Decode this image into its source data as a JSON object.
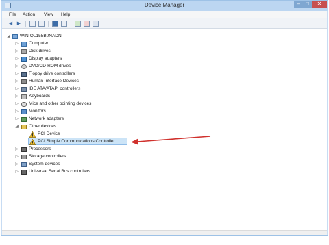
{
  "window": {
    "title": "Device Manager",
    "min_glyph": "–",
    "max_glyph": "□",
    "close_glyph": "✕"
  },
  "menu": {
    "items": [
      "File",
      "Action",
      "View",
      "Help"
    ]
  },
  "toolbar": {
    "buttons": [
      "back-icon",
      "forward-icon",
      "show-hide-tree-icon",
      "properties-icon",
      "help-icon",
      "scan-hardware-icon",
      "update-driver-icon",
      "disable-device-icon",
      "uninstall-icon"
    ],
    "back_glyph": "◀",
    "forward_glyph": "▶"
  },
  "tree": {
    "root": "WIN-QL155B0NADN",
    "collapsed_glyph": "▷",
    "expanded_glyph": "◢",
    "categories": [
      "Computer",
      "Disk drives",
      "Display adapters",
      "DVD/CD-ROM drives",
      "Floppy drive controllers",
      "Human Interface Devices",
      "IDE ATA/ATAPI controllers",
      "Keyboards",
      "Mice and other pointing devices",
      "Monitors",
      "Network adapters",
      "Other devices",
      "Processors",
      "Storage controllers",
      "System devices",
      "Universal Serial Bus controllers"
    ],
    "other_devices_children": [
      "PCI Device",
      "PCI Simple Communications Controller"
    ],
    "selected": "PCI Simple Communications Controller"
  },
  "colors": {
    "accent": "#3a6ea5",
    "selection": "#cce4f7",
    "annotation_arrow": "#d0312d",
    "warning": "#e8b400"
  }
}
